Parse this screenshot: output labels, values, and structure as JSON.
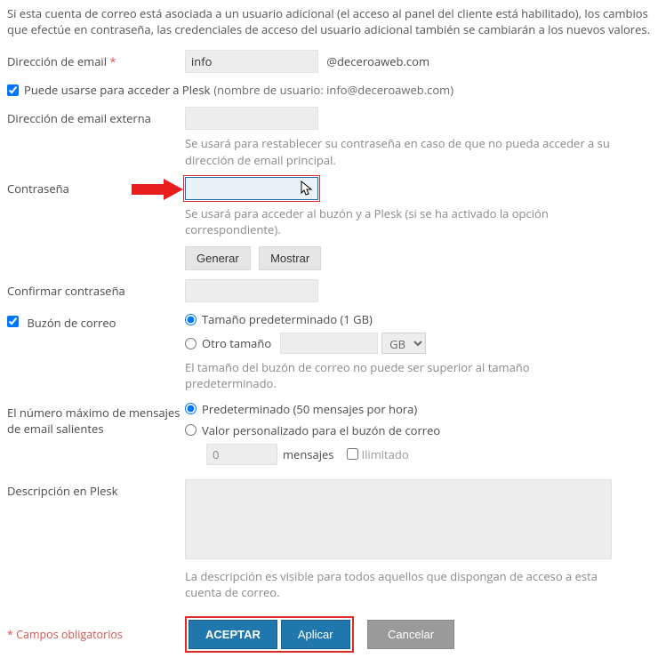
{
  "intro": "Si esta cuenta de correo está asociada a un usuario adicional (el acceso al panel del cliente está habilitado), los cambios que efectúe en contraseña, las credenciales de acceso del usuario adicional también se cambiarán a los nuevos valores.",
  "email": {
    "label": "Dirección de email",
    "value": "info",
    "domain": "@deceroaweb.com"
  },
  "plesk_access": {
    "label": "Puede usarse para acceder a Plesk",
    "username_note": "(nombre de usuario: info@deceroaweb.com)",
    "checked": true
  },
  "external_email": {
    "label": "Dirección de email externa",
    "value": "",
    "hint": "Se usará para restablecer su contraseña en caso de que no pueda acceder a su dirección de email principal."
  },
  "password": {
    "label": "Contraseña",
    "value": "",
    "hint": "Se usará para acceder al buzón y a Plesk (si se ha activado la opción correspondiente).",
    "generate": "Generar",
    "show": "Mostrar"
  },
  "confirm_password": {
    "label": "Confirmar contraseña",
    "value": ""
  },
  "mailbox": {
    "label": "Buzón de correo",
    "checked": true,
    "opt_default": "Tamaño predeterminado (1 GB)",
    "opt_custom": "Otro tamaño",
    "unit": "GB",
    "custom_value": "",
    "hint": "El tamaño del buzón de correo no puede ser superior al tamaño predeterminado."
  },
  "outgoing": {
    "label": "El número máximo de mensajes de email salientes",
    "opt_default": "Predeterminado (50 mensajes por hora)",
    "opt_custom": "Valor personalizado para el buzón de correo",
    "value": "0",
    "unit_label": "mensajes",
    "unlimited": "Ilimitado"
  },
  "description": {
    "label": "Descripción en Plesk",
    "value": "",
    "hint": "La descripción es visible para todos aquellos que dispongan de acceso a esta cuenta de correo."
  },
  "required_note": "* Campos obligatorios",
  "buttons": {
    "accept": "ACEPTAR",
    "apply": "Aplicar",
    "cancel": "Cancelar"
  }
}
